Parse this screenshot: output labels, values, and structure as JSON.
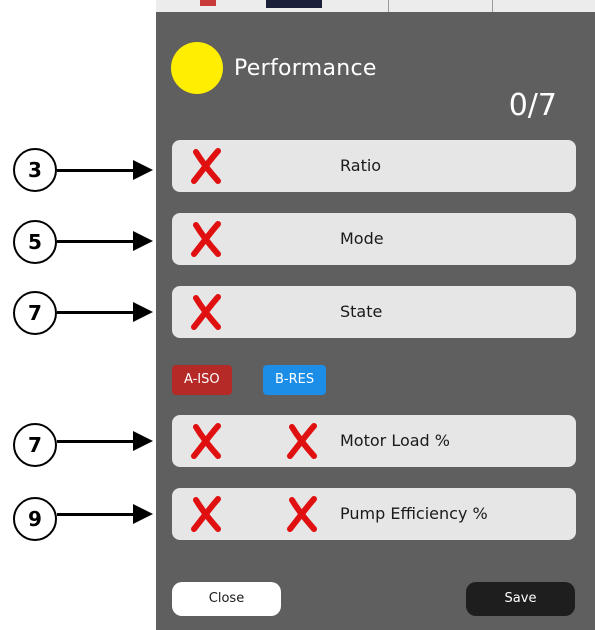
{
  "dialog": {
    "title": "Performance",
    "score": "0/7",
    "status_color": "#ffee00"
  },
  "rows": [
    {
      "label": "Ratio",
      "marks": 1
    },
    {
      "label": "Mode",
      "marks": 1
    },
    {
      "label": "State",
      "marks": 1
    },
    {
      "label": "Motor Load %",
      "marks": 2
    },
    {
      "label": "Pump Efficiency %",
      "marks": 2
    }
  ],
  "chips": {
    "a_label": "A-ISO",
    "b_label": "B-RES",
    "a_color": "#b52a26",
    "b_color": "#1c8ee8"
  },
  "buttons": {
    "close_label": "Close",
    "save_label": "Save"
  },
  "callouts": [
    "3",
    "5",
    "7",
    "7",
    "9"
  ],
  "icons": {
    "mark": "red-cross-icon",
    "mark_color": "#e01010"
  }
}
